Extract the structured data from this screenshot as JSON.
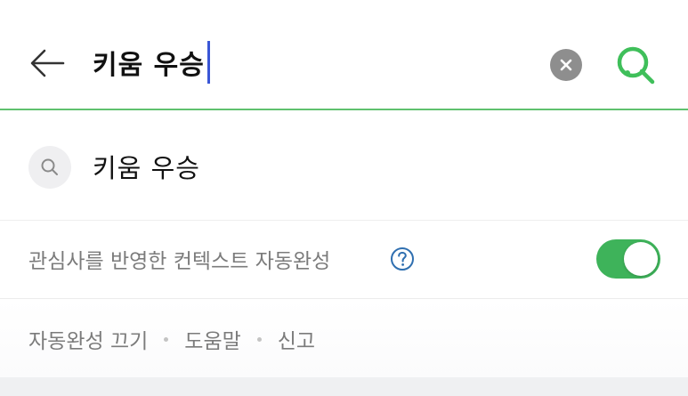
{
  "search": {
    "query": "키움 우승",
    "accent_color": "#5fc16f",
    "back_icon": "arrow-left-icon",
    "clear_icon": "close-icon",
    "submit_icon": "search-icon"
  },
  "suggestions": [
    {
      "text": "키움 우승",
      "icon": "search-icon"
    }
  ],
  "context_autocomplete": {
    "label": "관심사를 반영한 컨텍스트 자동완성",
    "help_icon": "question-icon",
    "enabled": true,
    "toggle_color": "#3eb35a"
  },
  "footer": {
    "links": [
      "자동완성 끄기",
      "도움말",
      "신고"
    ]
  }
}
